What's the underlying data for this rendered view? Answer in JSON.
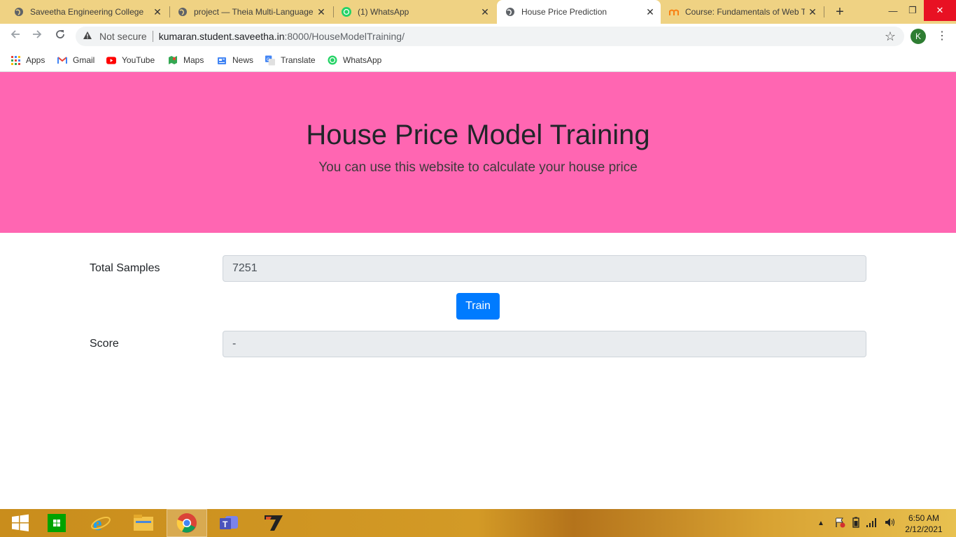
{
  "browser": {
    "tabs": [
      {
        "title": "Saveetha Engineering College",
        "icon": "globe-icon",
        "active": false
      },
      {
        "title": "project — Theia Multi-Language",
        "icon": "globe-icon",
        "active": false
      },
      {
        "title": "(1) WhatsApp",
        "icon": "whatsapp-icon",
        "active": false
      },
      {
        "title": "House Price Prediction",
        "icon": "globe-icon",
        "active": true
      },
      {
        "title": "Course: Fundamentals of Web T",
        "icon": "moodle-icon",
        "active": false
      }
    ],
    "new_tab": "+",
    "address": {
      "security": "Not secure",
      "host": "kumaran.student.saveetha.in",
      "path": ":8000/HouseModelTraining/"
    },
    "profile_initial": "K",
    "bookmarks": [
      {
        "label": "Apps",
        "icon": "apps-grid-icon"
      },
      {
        "label": "Gmail",
        "icon": "gmail-icon"
      },
      {
        "label": "YouTube",
        "icon": "youtube-icon"
      },
      {
        "label": "Maps",
        "icon": "maps-icon"
      },
      {
        "label": "News",
        "icon": "news-icon"
      },
      {
        "label": "Translate",
        "icon": "translate-icon"
      },
      {
        "label": "WhatsApp",
        "icon": "whatsapp-icon"
      }
    ]
  },
  "page": {
    "title": "House Price Model Training",
    "subtitle": "You can use this website to calculate your house price",
    "samples_label": "Total Samples",
    "samples_value": "7251",
    "train_button": "Train",
    "score_label": "Score",
    "score_value": "-"
  },
  "colors": {
    "hero": "#ff66b2",
    "button": "#007bff"
  },
  "taskbar": {
    "apps": [
      "windows-start-icon",
      "store-icon",
      "internet-explorer-icon",
      "file-explorer-icon",
      "chrome-icon",
      "teams-icon",
      "vlc-like-icon"
    ],
    "time": "6:50 AM",
    "date": "2/12/2021"
  }
}
